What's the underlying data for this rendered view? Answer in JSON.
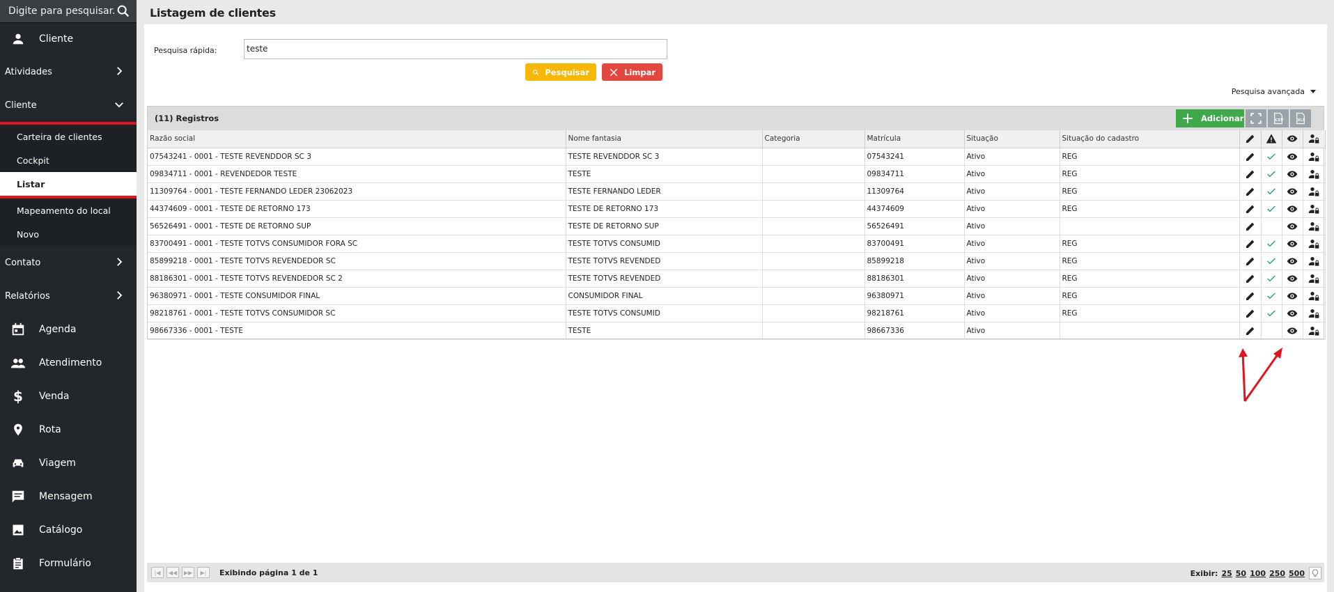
{
  "sidebar": {
    "search_placeholder": "Digite para pesquisar...",
    "items": [
      {
        "label": "Cliente"
      },
      {
        "label": "Atividades"
      },
      {
        "label": "Cliente"
      },
      {
        "label": "Contato"
      },
      {
        "label": "Relatórios"
      },
      {
        "label": "Agenda"
      },
      {
        "label": "Atendimento"
      },
      {
        "label": "Venda"
      },
      {
        "label": "Rota"
      },
      {
        "label": "Viagem"
      },
      {
        "label": "Mensagem"
      },
      {
        "label": "Catálogo"
      },
      {
        "label": "Formulário"
      }
    ],
    "subitems": [
      {
        "label": "Carteira de clientes"
      },
      {
        "label": "Cockpit"
      },
      {
        "label": "Listar"
      },
      {
        "label": "Mapeamento do local"
      },
      {
        "label": "Novo"
      }
    ]
  },
  "page": {
    "title": "Listagem de clientes",
    "quick_search_label": "Pesquisa rápida:",
    "quick_search_value": "teste",
    "search_button": "Pesquisar",
    "clear_button": "Limpar",
    "advanced_search": "Pesquisa avançada"
  },
  "grid": {
    "records_label": "(11) Registros",
    "add_button": "Adicionar",
    "columns": [
      "Razão social",
      "Nome fantasia",
      "Categoria",
      "Matrícula",
      "Situação",
      "Situação do cadastro"
    ],
    "rows": [
      {
        "razao": "07543241 - 0001 - TESTE REVENDDOR SC 3",
        "fantasia": "TESTE REVENDDOR SC 3",
        "categoria": "",
        "matricula": "07543241",
        "situacao": "Ativo",
        "cadastro": "REG"
      },
      {
        "razao": "09834711 - 0001 - REVENDEDOR TESTE",
        "fantasia": "TESTE",
        "categoria": "",
        "matricula": "09834711",
        "situacao": "Ativo",
        "cadastro": "REG"
      },
      {
        "razao": "11309764 - 0001 - TESTE FERNANDO LEDER 23062023",
        "fantasia": "TESTE FERNANDO LEDER",
        "categoria": "",
        "matricula": "11309764",
        "situacao": "Ativo",
        "cadastro": "REG"
      },
      {
        "razao": "44374609 - 0001 - TESTE DE RETORNO 173",
        "fantasia": "TESTE DE RETORNO 173",
        "categoria": "",
        "matricula": "44374609",
        "situacao": "Ativo",
        "cadastro": "REG"
      },
      {
        "razao": "56526491 - 0001 - TESTE DE RETORNO SUP",
        "fantasia": "TESTE DE RETORNO SUP",
        "categoria": "",
        "matricula": "56526491",
        "situacao": "Ativo",
        "cadastro": ""
      },
      {
        "razao": "83700491 - 0001 - TESTE TOTVS CONSUMIDOR FORA SC",
        "fantasia": "TESTE TOTVS CONSUMID",
        "categoria": "",
        "matricula": "83700491",
        "situacao": "Ativo",
        "cadastro": "REG"
      },
      {
        "razao": "85899218 - 0001 - TESTE TOTVS REVENDEDOR SC",
        "fantasia": "TESTE TOTVS REVENDED",
        "categoria": "",
        "matricula": "85899218",
        "situacao": "Ativo",
        "cadastro": "REG"
      },
      {
        "razao": "88186301 - 0001 - TESTE TOTVS REVENDEDOR SC 2",
        "fantasia": "TESTE TOTVS REVENDED",
        "categoria": "",
        "matricula": "88186301",
        "situacao": "Ativo",
        "cadastro": "REG"
      },
      {
        "razao": "96380971 - 0001 - TESTE CONSUMIDOR FINAL",
        "fantasia": "CONSUMIDOR FINAL",
        "categoria": "",
        "matricula": "96380971",
        "situacao": "Ativo",
        "cadastro": "REG"
      },
      {
        "razao": "98218761 - 0001 - TESTE TOTVS CONSUMIDOR SC",
        "fantasia": "TESTE TOTVS CONSUMID",
        "categoria": "",
        "matricula": "98218761",
        "situacao": "Ativo",
        "cadastro": "REG"
      },
      {
        "razao": "98667336 - 0001 - TESTE",
        "fantasia": "TESTE",
        "categoria": "",
        "matricula": "98667336",
        "situacao": "Ativo",
        "cadastro": ""
      }
    ]
  },
  "pager": {
    "info": "Exibindo página 1 de 1",
    "show_label": "Exibir:",
    "sizes": [
      "25",
      "50",
      "100",
      "250",
      "500"
    ]
  },
  "colors": {
    "sidebar_bg": "#23272b",
    "accent_red": "#e0141e",
    "search_yellow": "#f7b707",
    "clear_red": "#e24840",
    "add_green": "#3ea84a",
    "check_teal": "#1a9a7a"
  }
}
